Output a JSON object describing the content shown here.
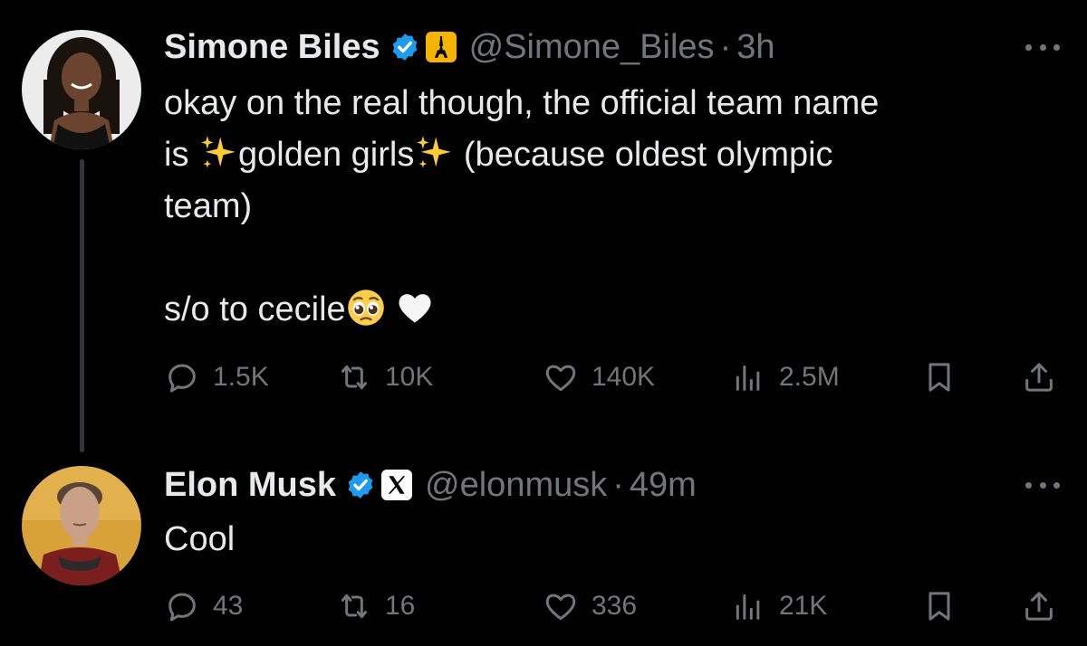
{
  "colors": {
    "background": "#000000",
    "text_primary": "#e7e9ea",
    "text_secondary": "#71767b",
    "verified_blue": "#1d9bf0",
    "thread_line": "#333639",
    "affiliation_gold": "#f4b400"
  },
  "tweets": [
    {
      "author": {
        "name": "Simone Biles",
        "handle": "@Simone_Biles",
        "verified_icon": "verified-badge-icon",
        "affiliation_icon": "eiffel-tower-icon"
      },
      "separator": "·",
      "time": "3h",
      "body": {
        "line1": "okay on the real though, the official team name",
        "line2_a": "is ",
        "line2_b": "golden girls",
        "line2_c": " (because oldest olympic",
        "line3": "team)",
        "line5": "s/o to cecile",
        "emojis": [
          "sparkles",
          "sparkles",
          "pleading-face",
          "white-heart"
        ]
      },
      "stats": {
        "replies": "1.5K",
        "reposts": "10K",
        "likes": "140K",
        "views": "2.5M"
      }
    },
    {
      "author": {
        "name": "Elon Musk",
        "handle": "@elonmusk",
        "verified_icon": "verified-badge-icon",
        "affiliation_icon": "x-logo-icon"
      },
      "separator": "·",
      "time": "49m",
      "body": {
        "line1": "Cool"
      },
      "stats": {
        "replies": "43",
        "reposts": "16",
        "likes": "336",
        "views": "21K"
      }
    }
  ]
}
